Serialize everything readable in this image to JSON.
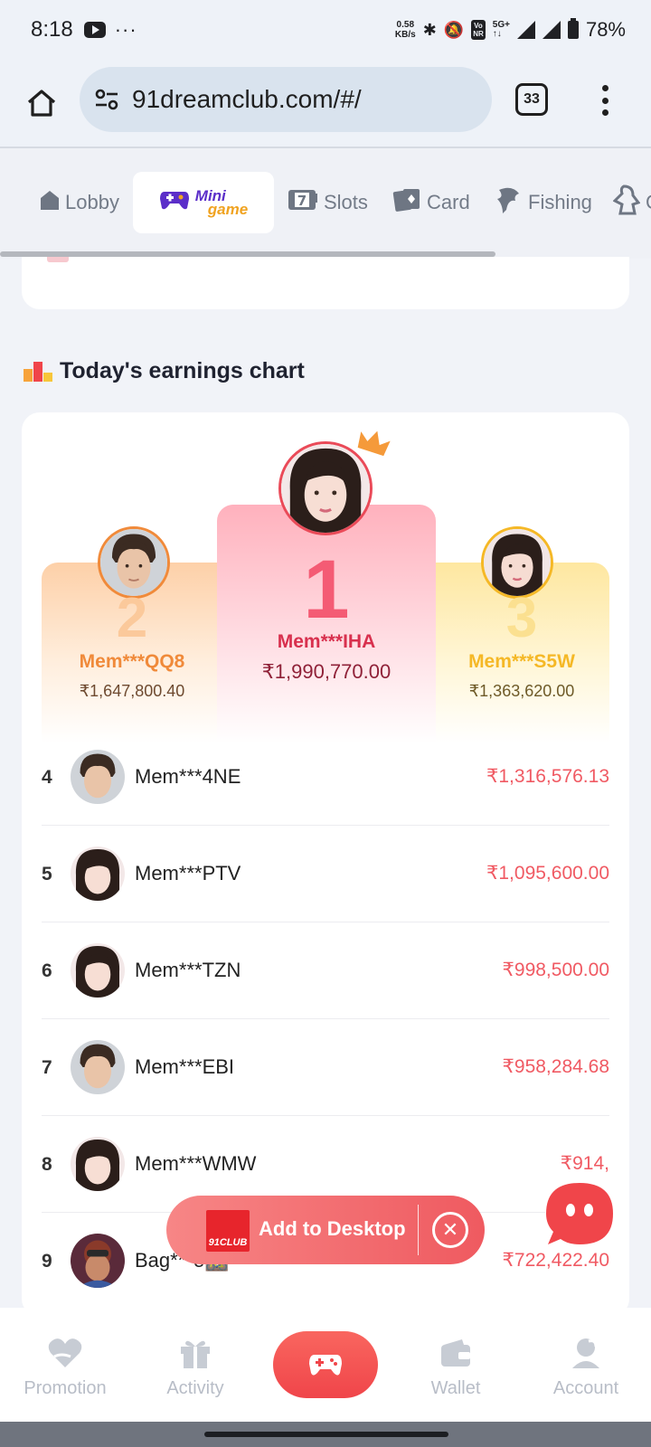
{
  "status": {
    "time": "8:18",
    "dots": "···",
    "speed_top": "0.58",
    "speed_bottom": "KB/s",
    "volte_top": "Vo",
    "volte_bottom": "NR",
    "network_top": "5G+",
    "network_bottom": "↑↓",
    "battery": "78%"
  },
  "browser": {
    "url": "91dreamclub.com/#/",
    "tab_count": "33"
  },
  "categories": [
    {
      "label": "Lobby",
      "icon": "house-icon"
    },
    {
      "label": "Mini",
      "label2": "game",
      "icon": "gamepad-icon",
      "active": true
    },
    {
      "label": "Slots",
      "icon": "slot-7-icon"
    },
    {
      "label": "Card",
      "icon": "cards-icon"
    },
    {
      "label": "Fishing",
      "icon": "fish-icon"
    },
    {
      "label": "C",
      "icon": "figure-icon"
    }
  ],
  "section": {
    "title": "Today's earnings chart"
  },
  "podium": [
    {
      "rank": "1",
      "name": "Mem***IHA",
      "amount": "₹1,990,770.00",
      "avatar": "female"
    },
    {
      "rank": "2",
      "name": "Mem***QQ8",
      "amount": "₹1,647,800.40",
      "avatar": "male"
    },
    {
      "rank": "3",
      "name": "Mem***S5W",
      "amount": "₹1,363,620.00",
      "avatar": "female"
    }
  ],
  "ranking": [
    {
      "rank": "4",
      "name": "Mem***4NE",
      "amount": "₹1,316,576.13",
      "avatar": "male"
    },
    {
      "rank": "5",
      "name": "Mem***PTV",
      "amount": "₹1,095,600.00",
      "avatar": "female"
    },
    {
      "rank": "6",
      "name": "Mem***TZN",
      "amount": "₹998,500.00",
      "avatar": "female"
    },
    {
      "rank": "7",
      "name": "Mem***EBI",
      "amount": "₹958,284.68",
      "avatar": "male"
    },
    {
      "rank": "8",
      "name": "Mem***WMW",
      "amount": "₹914,",
      "avatar": "female"
    },
    {
      "rank": "9",
      "name": "Bag***e🚵",
      "amount": "₹722,422.40",
      "avatar": "gamer"
    }
  ],
  "add_desktop": {
    "label": "Add to Desktop",
    "logo_text": "91CLUB",
    "close": "✕"
  },
  "bottom_nav": {
    "promotion": "Promotion",
    "activity": "Activity",
    "wallet": "Wallet",
    "account": "Account"
  },
  "colors": {
    "accent": "#f0454a",
    "rank1": "#d8304e",
    "rank2": "#f08a3a",
    "rank3": "#f5b826",
    "amount": "#f05a63"
  }
}
